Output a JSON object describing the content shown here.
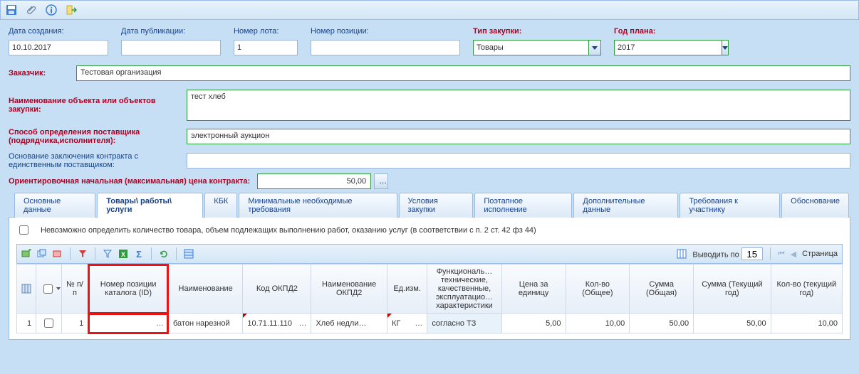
{
  "fields": {
    "creation_date_label": "Дата создания:",
    "creation_date_value": "10.10.2017",
    "pub_date_label": "Дата публикации:",
    "pub_date_value": "",
    "lot_no_label": "Номер лота:",
    "lot_no_value": "1",
    "pos_no_label": "Номер позиции:",
    "pos_no_value": "",
    "purchase_type_label": "Тип закупки:",
    "purchase_type_value": "Товары",
    "plan_year_label": "Год плана:",
    "plan_year_value": "2017",
    "customer_label": "Заказчик:",
    "customer_value": "Тестовая организация",
    "obj_name_label": "Наименование объекта или объектов закупки:",
    "obj_name_value": "тест хлеб",
    "supplier_method_label": "Способ определения поставщика (подрядчика,исполнителя):",
    "supplier_method_value": "электронный аукцион",
    "single_supplier_basis_label": "Основание заключения контракта с единственным поставщиком:",
    "single_supplier_basis_value": "",
    "price_label": "Ориентировочная начальная (максимальная) цена контракта:",
    "price_value": "50,00"
  },
  "tabs": [
    "Основные данные",
    "Товары\\ работы\\ услуги",
    "КБК",
    "Минимальные необходимые требования",
    "Условия закупки",
    "Поэтапное исполнение",
    "Дополнительные данные",
    "Требования к участнику",
    "Обоснование"
  ],
  "active_tab": "Товары\\ работы\\ услуги",
  "chk_text": "Невозможно определить количество товара, объем подлежащих выполнению работ, оказанию услуг (в соответствии с п. 2 ст. 42 фз 44)",
  "pager": {
    "show_label": "Выводить по",
    "show_value": "15",
    "page_label": "Страница"
  },
  "grid": {
    "headers": {
      "row_no": "№ п/п",
      "catalog_pos": "Номер позиции каталога (ID)",
      "name": "Наименование",
      "okpd2_code": "Код ОКПД2",
      "okpd2_name": "Наименование ОКПД2",
      "unit": "Ед.изм.",
      "characteristics": "Функциональ… технические, качественные, эксплуатацио… характеристики",
      "price_per_unit": "Цена за единицу",
      "qty_total": "Кол-во (Общее)",
      "sum_total": "Сумма (Общая)",
      "sum_cur_year": "Сумма (Текущий год)",
      "qty_cur_year": "Кол-во (текущий год)"
    },
    "row": {
      "idx": "1",
      "row_no": "1",
      "catalog_pos": "",
      "name": "батон нарезной",
      "okpd2_code": "10.71.11.110",
      "okpd2_name": "Хлеб недли…",
      "unit": "КГ",
      "characteristics": "согласно ТЗ",
      "price_per_unit": "5,00",
      "qty_total": "10,00",
      "sum_total": "50,00",
      "sum_cur_year": "50,00",
      "qty_cur_year": "10,00"
    }
  }
}
